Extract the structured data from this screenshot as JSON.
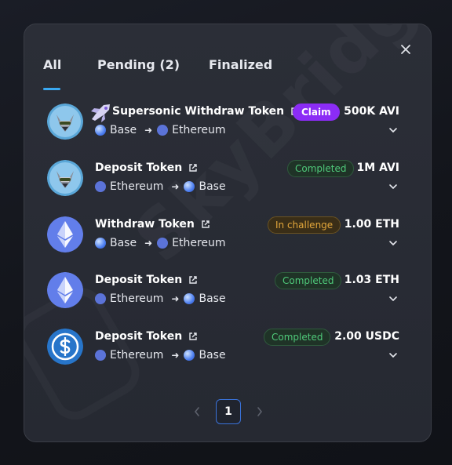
{
  "tabs": [
    {
      "label": "All",
      "active": true
    },
    {
      "label": "Pending (2)",
      "active": false
    },
    {
      "label": "Finalized",
      "active": false
    }
  ],
  "transactions": [
    {
      "title": "Supersonic Withdraw Token",
      "from": "Base",
      "to": "Ethereum",
      "status": "Claim",
      "amount": "500K AVI",
      "avatar": "wolf-avatar"
    },
    {
      "title": "Deposit Token",
      "from": "Ethereum",
      "to": "Base",
      "status": "Completed",
      "amount": "1M AVI",
      "avatar": "wolf-avatar"
    },
    {
      "title": "Withdraw Token",
      "from": "Base",
      "to": "Ethereum",
      "status": "In challenge",
      "amount": "1.00 ETH",
      "avatar": "ethereum-icon"
    },
    {
      "title": "Deposit Token",
      "from": "Ethereum",
      "to": "Base",
      "status": "Completed",
      "amount": "1.03 ETH",
      "avatar": "ethereum-icon"
    },
    {
      "title": "Deposit Token",
      "from": "Ethereum",
      "to": "Base",
      "status": "Completed",
      "amount": "2.00 USDC",
      "avatar": "usdc-icon"
    }
  ],
  "pagination": {
    "current_page": "1"
  },
  "colors": {
    "accent": "#3aa9f2",
    "claim": "#8b2cf5",
    "completed": "#4fc97a",
    "challenge": "#e3a73b"
  }
}
